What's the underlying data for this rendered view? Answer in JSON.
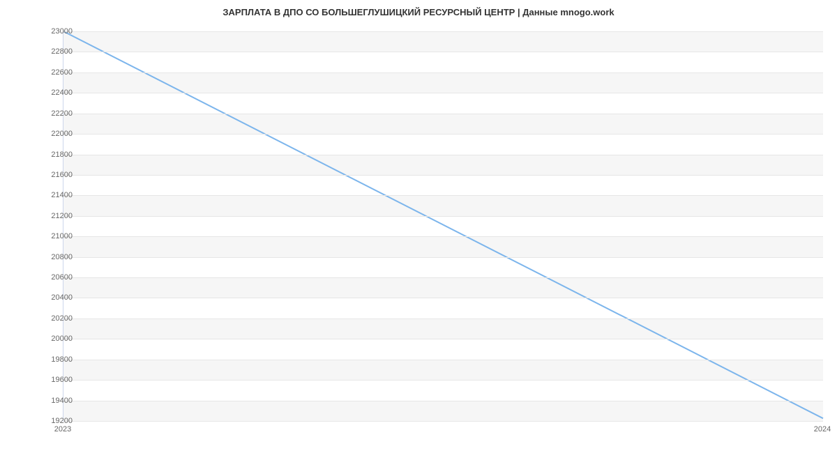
{
  "chart_data": {
    "type": "line",
    "title": "ЗАРПЛАТА В ДПО СО БОЛЬШЕГЛУШИЦКИЙ РЕСУРСНЫЙ ЦЕНТР | Данные mnogo.work",
    "xlabel": "",
    "ylabel": "",
    "x": [
      "2023",
      "2024"
    ],
    "values": [
      23000,
      19225
    ],
    "ylim": [
      19200,
      23000
    ],
    "y_ticks": [
      19200,
      19400,
      19600,
      19800,
      20000,
      20200,
      20400,
      20600,
      20800,
      21000,
      21200,
      21400,
      21600,
      21800,
      22000,
      22200,
      22400,
      22600,
      22800,
      23000
    ],
    "x_ticks": [
      "2023",
      "2024"
    ],
    "line_color": "#7cb5ec",
    "band_color": "#f6f6f6"
  }
}
